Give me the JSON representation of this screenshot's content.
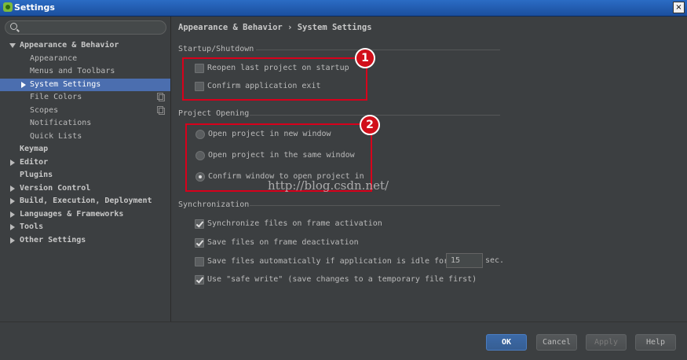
{
  "window": {
    "title": "Settings",
    "close_glyph": "×"
  },
  "search": {
    "placeholder": "",
    "value": ""
  },
  "sidebar": {
    "items": [
      {
        "label": "Appearance & Behavior"
      },
      {
        "label": "Appearance"
      },
      {
        "label": "Menus and Toolbars"
      },
      {
        "label": "System Settings"
      },
      {
        "label": "File Colors"
      },
      {
        "label": "Scopes"
      },
      {
        "label": "Notifications"
      },
      {
        "label": "Quick Lists"
      },
      {
        "label": "Keymap"
      },
      {
        "label": "Editor"
      },
      {
        "label": "Plugins"
      },
      {
        "label": "Version Control"
      },
      {
        "label": "Build, Execution, Deployment"
      },
      {
        "label": "Languages & Frameworks"
      },
      {
        "label": "Tools"
      },
      {
        "label": "Other Settings"
      }
    ],
    "selected": "System Settings"
  },
  "main": {
    "breadcrumb": "Appearance & Behavior › System Settings",
    "startup": {
      "title": "Startup/Shutdown",
      "reopen_label": "Reopen last project on startup",
      "reopen_checked": false,
      "confirm_exit_label": "Confirm application exit",
      "confirm_exit_checked": false
    },
    "opening": {
      "title": "Project Opening",
      "new_window_label": "Open project in new window",
      "same_window_label": "Open project in the same window",
      "confirm_label": "Confirm window to open project in",
      "selected": "Confirm window to open project in"
    },
    "sync": {
      "title": "Synchronization",
      "frame_activation_label": "Synchronize files on frame activation",
      "frame_activation_checked": true,
      "frame_deactivation_label": "Save files on frame deactivation",
      "frame_deactivation_checked": true,
      "idle_label": "Save files automatically if application is idle for",
      "idle_checked": false,
      "idle_value": "15",
      "idle_unit": "sec.",
      "safe_write_label": "Use \"safe write\" (save changes to a temporary file first)",
      "safe_write_checked": true
    }
  },
  "annotations": {
    "badge_1": "1",
    "badge_2": "2",
    "watermark": "http://blog.csdn.net/",
    "color": "#d8001b"
  },
  "buttons": {
    "ok": "OK",
    "cancel": "Cancel",
    "apply": "Apply",
    "help": "Help"
  },
  "colors": {
    "background": "#3c3f41",
    "selection": "#4b6eaf",
    "titlebar": "#2b6cc4",
    "primary_button": "#3c6aa8"
  }
}
